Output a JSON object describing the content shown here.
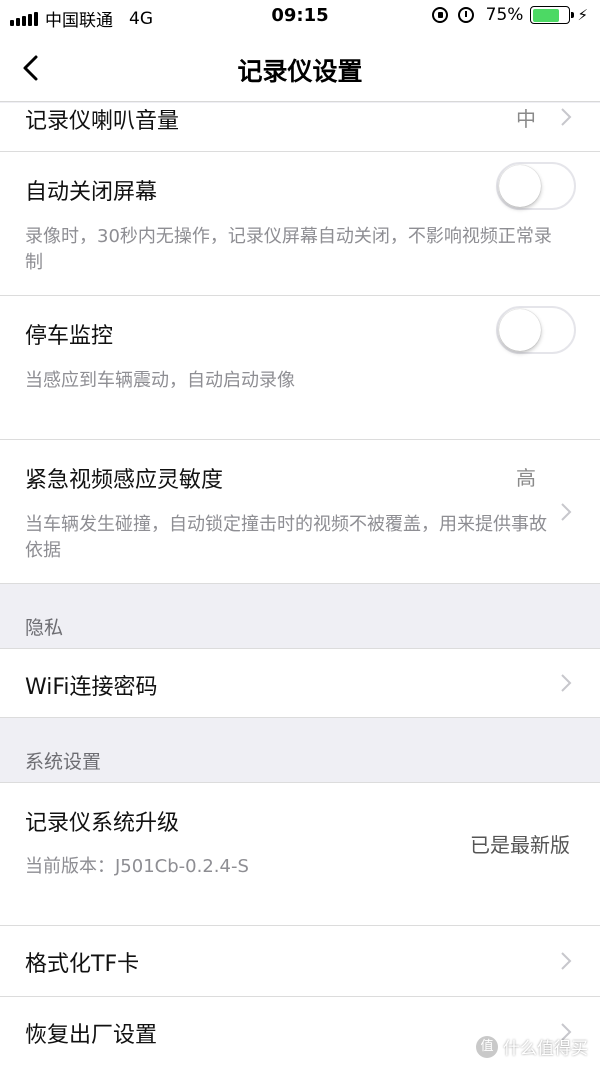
{
  "status_bar": {
    "carrier": "中国联通",
    "network": "4G",
    "time": "09:15",
    "battery": "75%",
    "battery_level": 0.75
  },
  "nav": {
    "title": "记录仪设置"
  },
  "rows": {
    "speaker_volume": {
      "title": "记录仪喇叭音量",
      "value": "中"
    },
    "auto_screen_off": {
      "title": "自动关闭屏幕",
      "desc": "录像时，30秒内无操作，记录仪屏幕自动关闭，不影响视频正常录制",
      "enabled": false
    },
    "parking_monitor": {
      "title": "停车监控",
      "desc": "当感应到车辆震动，自动启动录像",
      "enabled": false
    },
    "emergency_sensitivity": {
      "title": "紧急视频感应灵敏度",
      "value": "高",
      "desc": "当车辆发生碰撞，自动锁定撞击时的视频不被覆盖，用来提供事故依据"
    }
  },
  "privacy": {
    "header": "隐私",
    "wifi_password": "WiFi连接密码"
  },
  "system": {
    "header": "系统设置",
    "upgrade_title": "记录仪系统升级",
    "version": "当前版本：J501Cb-0.2.4-S",
    "upgrade_status": "已是最新版",
    "format_tf": "格式化TF卡",
    "factory_reset": "恢复出厂设置"
  },
  "watermark": {
    "badge": "值",
    "text": "什么值得买"
  },
  "colors": {
    "background": "#efeff4",
    "battery_fill": "#4cd964",
    "secondary_text": "#8e8e93"
  }
}
